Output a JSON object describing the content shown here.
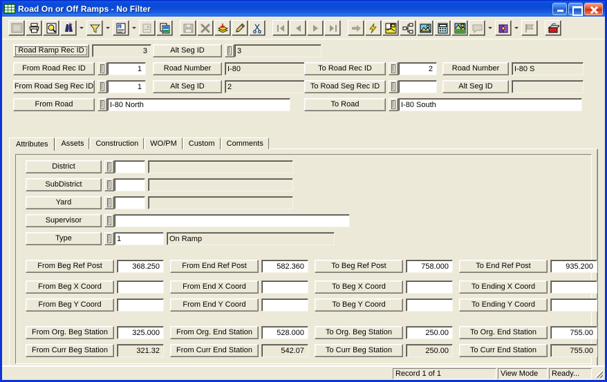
{
  "window": {
    "title": "Road On or Off Ramps - No Filter",
    "icon": "grid-table-icon",
    "minimize_label": "Minimize",
    "maximize_label": "Maximize",
    "close_label": "Close",
    "accent_color": "#0a4ddc",
    "face_color": "#ece9d8"
  },
  "toolbar": {
    "groups": [
      {
        "buttons": [
          {
            "name": "new-record-button",
            "icon": "new-record-icon",
            "enabled": false
          },
          {
            "name": "print-button",
            "icon": "printer-icon",
            "enabled": true
          },
          {
            "name": "print-preview-button",
            "icon": "print-preview-icon",
            "enabled": true
          },
          {
            "name": "find-button",
            "icon": "binoculars-icon",
            "enabled": true,
            "dropdown": true
          },
          {
            "name": "filter-button",
            "icon": "funnel-icon",
            "enabled": true,
            "dropdown": true
          },
          {
            "name": "report-button",
            "icon": "report-icon",
            "enabled": true,
            "dropdown": true
          },
          {
            "name": "properties-button",
            "icon": "properties-icon",
            "enabled": false
          },
          {
            "name": "copy-record-button",
            "icon": "copy-pages-icon",
            "enabled": true
          }
        ]
      },
      {
        "buttons": [
          {
            "name": "save-button",
            "icon": "floppy-disk-icon",
            "enabled": false
          },
          {
            "name": "delete-button",
            "icon": "x-delete-icon",
            "enabled": false
          },
          {
            "name": "post-button",
            "icon": "stack-post-icon",
            "enabled": true
          },
          {
            "name": "edit-button",
            "icon": "pencil-icon",
            "enabled": true
          },
          {
            "name": "cut-button",
            "icon": "scissors-icon",
            "enabled": true
          }
        ]
      },
      {
        "buttons": [
          {
            "name": "first-record-button",
            "icon": "first-record-icon",
            "enabled": false
          },
          {
            "name": "previous-record-button",
            "icon": "previous-record-icon",
            "enabled": false
          },
          {
            "name": "next-record-button",
            "icon": "next-record-icon",
            "enabled": false
          },
          {
            "name": "last-record-button",
            "icon": "last-record-icon",
            "enabled": false
          }
        ]
      },
      {
        "buttons": [
          {
            "name": "goto-button",
            "icon": "right-arrow-icon",
            "enabled": false
          },
          {
            "name": "execute-button",
            "icon": "lightning-bolt-icon",
            "enabled": true
          },
          {
            "name": "map-view-button",
            "icon": "map-view-icon",
            "enabled": true
          },
          {
            "name": "tree-view-button",
            "icon": "tree-structure-icon",
            "enabled": true
          },
          {
            "name": "image-button",
            "icon": "picture-frame-icon",
            "enabled": true
          },
          {
            "name": "calculator-button",
            "icon": "calculator-icon",
            "enabled": true
          },
          {
            "name": "gis-button",
            "icon": "gis-map-icon",
            "enabled": true
          },
          {
            "name": "comment-button",
            "icon": "speech-bubble-icon",
            "enabled": false,
            "dropdown": true
          },
          {
            "name": "help-book-button",
            "icon": "book-icon",
            "enabled": true,
            "dropdown": true
          },
          {
            "name": "flag-button",
            "icon": "flag-icon",
            "enabled": false
          }
        ]
      },
      {
        "buttons": [
          {
            "name": "exit-button",
            "icon": "exit-door-icon",
            "enabled": true
          }
        ]
      }
    ]
  },
  "header": {
    "road_ramp_rec_id": {
      "label": "Road Ramp Rec ID",
      "value": "3",
      "readonly": true,
      "focused": true
    },
    "alt_seg_id_top": {
      "label": "Alt Seg ID",
      "value": "3",
      "readonly": true
    },
    "from_road_rec_id": {
      "label": "From Road Rec ID",
      "value": "1"
    },
    "from_road_seg_rec_id": {
      "label": "From Road Seg Rec ID",
      "value": "1"
    },
    "from_road": {
      "label": "From Road",
      "value": "I-80 North"
    },
    "from_road_number": {
      "label": "Road Number",
      "value": "I-80",
      "readonly": true
    },
    "from_alt_seg_id": {
      "label": "Alt Seg ID",
      "value": "2",
      "readonly": true
    },
    "to_road_rec_id": {
      "label": "To Road Rec ID",
      "value": "2"
    },
    "to_road_seg_rec_id": {
      "label": "To Road Seg Rec ID",
      "value": ""
    },
    "to_road": {
      "label": "To Road",
      "value": "I-80 South"
    },
    "to_road_number": {
      "label": "Road Number",
      "value": "I-80 S",
      "readonly": true
    },
    "to_alt_seg_id": {
      "label": "Alt Seg ID",
      "value": "",
      "readonly": true
    }
  },
  "tabs": {
    "items": [
      {
        "label": "Attributes",
        "name": "tab-attributes",
        "active": true
      },
      {
        "label": "Assets",
        "name": "tab-assets",
        "active": false
      },
      {
        "label": "Construction",
        "name": "tab-construction",
        "active": false
      },
      {
        "label": "WO/PM",
        "name": "tab-wo-pm",
        "active": false
      },
      {
        "label": "Custom",
        "name": "tab-custom",
        "active": false
      },
      {
        "label": "Comments",
        "name": "tab-comments",
        "active": false
      }
    ]
  },
  "attributes": {
    "lookups": [
      {
        "name": "district",
        "label": "District",
        "code": "",
        "description": ""
      },
      {
        "name": "subdistrict",
        "label": "SubDistrict",
        "code": "",
        "description": ""
      },
      {
        "name": "yard",
        "label": "Yard",
        "code": "",
        "description": ""
      }
    ],
    "supervisor": {
      "label": "Supervisor",
      "value": ""
    },
    "type": {
      "label": "Type",
      "code": "1",
      "description": "On Ramp"
    },
    "measurements": [
      {
        "row": 1,
        "cells": [
          {
            "name": "from-beg-ref-post",
            "label": "From Beg Ref Post",
            "value": "368.250",
            "readonly": false
          },
          {
            "name": "from-end-ref-post",
            "label": "From End Ref Post",
            "value": "582.360",
            "readonly": false
          },
          {
            "name": "to-beg-ref-post",
            "label": "To Beg Ref Post",
            "value": "758.000",
            "readonly": false
          },
          {
            "name": "to-end-ref-post",
            "label": "To End Ref Post",
            "value": "935.200",
            "readonly": false
          }
        ]
      },
      {
        "row": 2,
        "cells": [
          {
            "name": "from-beg-x-coord",
            "label": "From Beg X Coord",
            "value": "",
            "readonly": false
          },
          {
            "name": "from-end-x-coord",
            "label": "From End X Coord",
            "value": "",
            "readonly": false
          },
          {
            "name": "to-beg-x-coord",
            "label": "To Beg X Coord",
            "value": "",
            "readonly": false
          },
          {
            "name": "to-ending-x-coord",
            "label": "To Ending X Coord",
            "value": "",
            "readonly": false
          }
        ]
      },
      {
        "row": 3,
        "cells": [
          {
            "name": "from-beg-y-coord",
            "label": "From Beg Y Coord",
            "value": "",
            "readonly": false
          },
          {
            "name": "from-end-y-coord",
            "label": "From End Y Coord",
            "value": "",
            "readonly": false
          },
          {
            "name": "to-beg-y-coord",
            "label": "To Beg Y Coord",
            "value": "",
            "readonly": false
          },
          {
            "name": "to-ending-y-coord",
            "label": "To Ending Y Coord",
            "value": "",
            "readonly": false
          }
        ]
      },
      {
        "row": 4,
        "cells": [
          {
            "name": "from-org-beg-station",
            "label": "From Org. Beg Station",
            "value": "325.000",
            "readonly": false
          },
          {
            "name": "from-org-end-station",
            "label": "From Org. End Station",
            "value": "528.000",
            "readonly": false
          },
          {
            "name": "to-org-beg-station",
            "label": "To Org. Beg Station",
            "value": "250.00",
            "readonly": false
          },
          {
            "name": "to-org-end-station",
            "label": "To Org. End Station",
            "value": "755.00",
            "readonly": false
          }
        ]
      },
      {
        "row": 5,
        "cells": [
          {
            "name": "from-curr-beg-station",
            "label": "From Curr Beg Station",
            "value": "321.32",
            "readonly": true
          },
          {
            "name": "from-curr-end-station",
            "label": "From Curr End Station",
            "value": "542.07",
            "readonly": true
          },
          {
            "name": "to-curr-beg-station",
            "label": "To Curr Beg Station",
            "value": "250.00",
            "readonly": true
          },
          {
            "name": "to-curr-end-station",
            "label": "To Curr End Station",
            "value": "755.00",
            "readonly": true
          }
        ]
      }
    ]
  },
  "status_bar": {
    "record": "Record 1 of 1",
    "mode": "View Mode",
    "state": "Ready..."
  }
}
